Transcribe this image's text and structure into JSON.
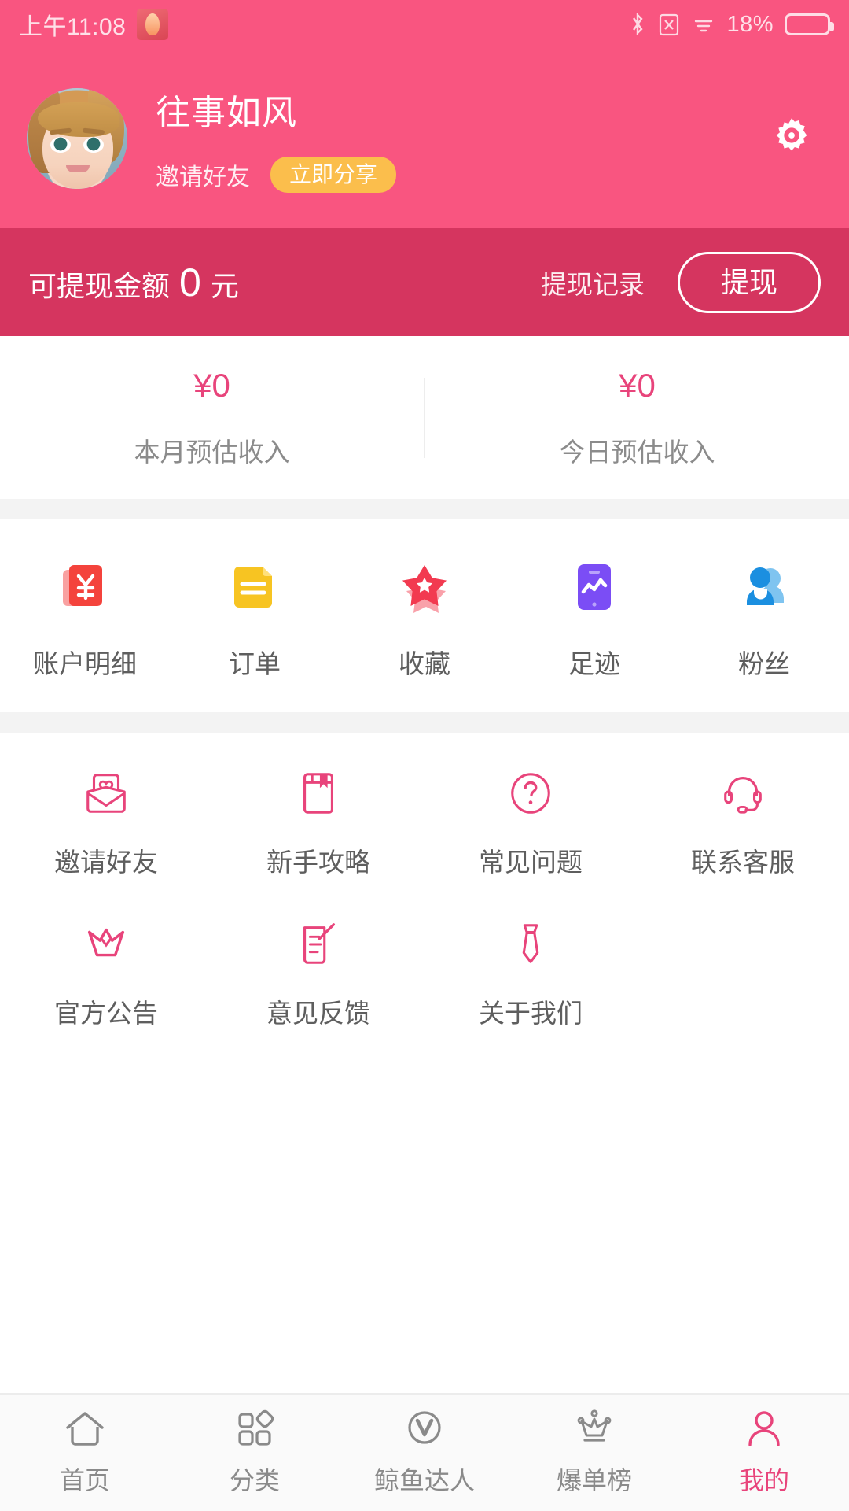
{
  "status_bar": {
    "time": "上午11:08",
    "battery": "18%",
    "icons": [
      "app-icon",
      "bluetooth-icon",
      "sim-icon",
      "wifi-icon",
      "battery-icon"
    ]
  },
  "profile": {
    "username": "往事如风",
    "invite_text": "邀请好友",
    "share_button": "立即分享",
    "settings_icon": "gear-icon",
    "avatar": "user-avatar",
    "bg_color": "#F95580"
  },
  "withdraw": {
    "label": "可提现金额",
    "amount": "0",
    "unit": "元",
    "record_link": "提现记录",
    "button": "提现",
    "bg_color": "#D5355F"
  },
  "earnings": {
    "accent_color": "#E8447B",
    "cells": [
      {
        "value": "¥0",
        "label": "本月预估收入"
      },
      {
        "value": "¥0",
        "label": "今日预估收入"
      }
    ]
  },
  "quick_actions": [
    {
      "label": "账户明细",
      "icon": "money-card-icon",
      "color": "#F4433C"
    },
    {
      "label": "订单",
      "icon": "document-icon",
      "color": "#F7C422"
    },
    {
      "label": "收藏",
      "icon": "star-icon",
      "color": "#F23A50"
    },
    {
      "label": "足迹",
      "icon": "phone-chart-icon",
      "color": "#7B4DF5"
    },
    {
      "label": "粉丝",
      "icon": "fans-icon",
      "color": "#1B8FE0"
    }
  ],
  "menu": {
    "icon_color": "#E8447B",
    "rows": [
      [
        {
          "label": "邀请好友",
          "icon": "envelope-heart-icon"
        },
        {
          "label": "新手攻略",
          "icon": "book-bookmark-icon"
        },
        {
          "label": "常见问题",
          "icon": "question-circle-icon"
        },
        {
          "label": "联系客服",
          "icon": "headset-icon"
        }
      ],
      [
        {
          "label": "官方公告",
          "icon": "crown-icon"
        },
        {
          "label": "意见反馈",
          "icon": "feedback-pen-icon"
        },
        {
          "label": "关于我们",
          "icon": "necktie-icon"
        }
      ]
    ]
  },
  "tabbar": {
    "active_color": "#E8447B",
    "inactive_color": "#8a8a8a",
    "items": [
      {
        "label": "首页",
        "icon": "home-icon",
        "active": false
      },
      {
        "label": "分类",
        "icon": "grid-icon",
        "active": false
      },
      {
        "label": "鲸鱼达人",
        "icon": "v-circle-icon",
        "active": false
      },
      {
        "label": "爆单榜",
        "icon": "crown-rank-icon",
        "active": false
      },
      {
        "label": "我的",
        "icon": "person-icon",
        "active": true
      }
    ]
  }
}
